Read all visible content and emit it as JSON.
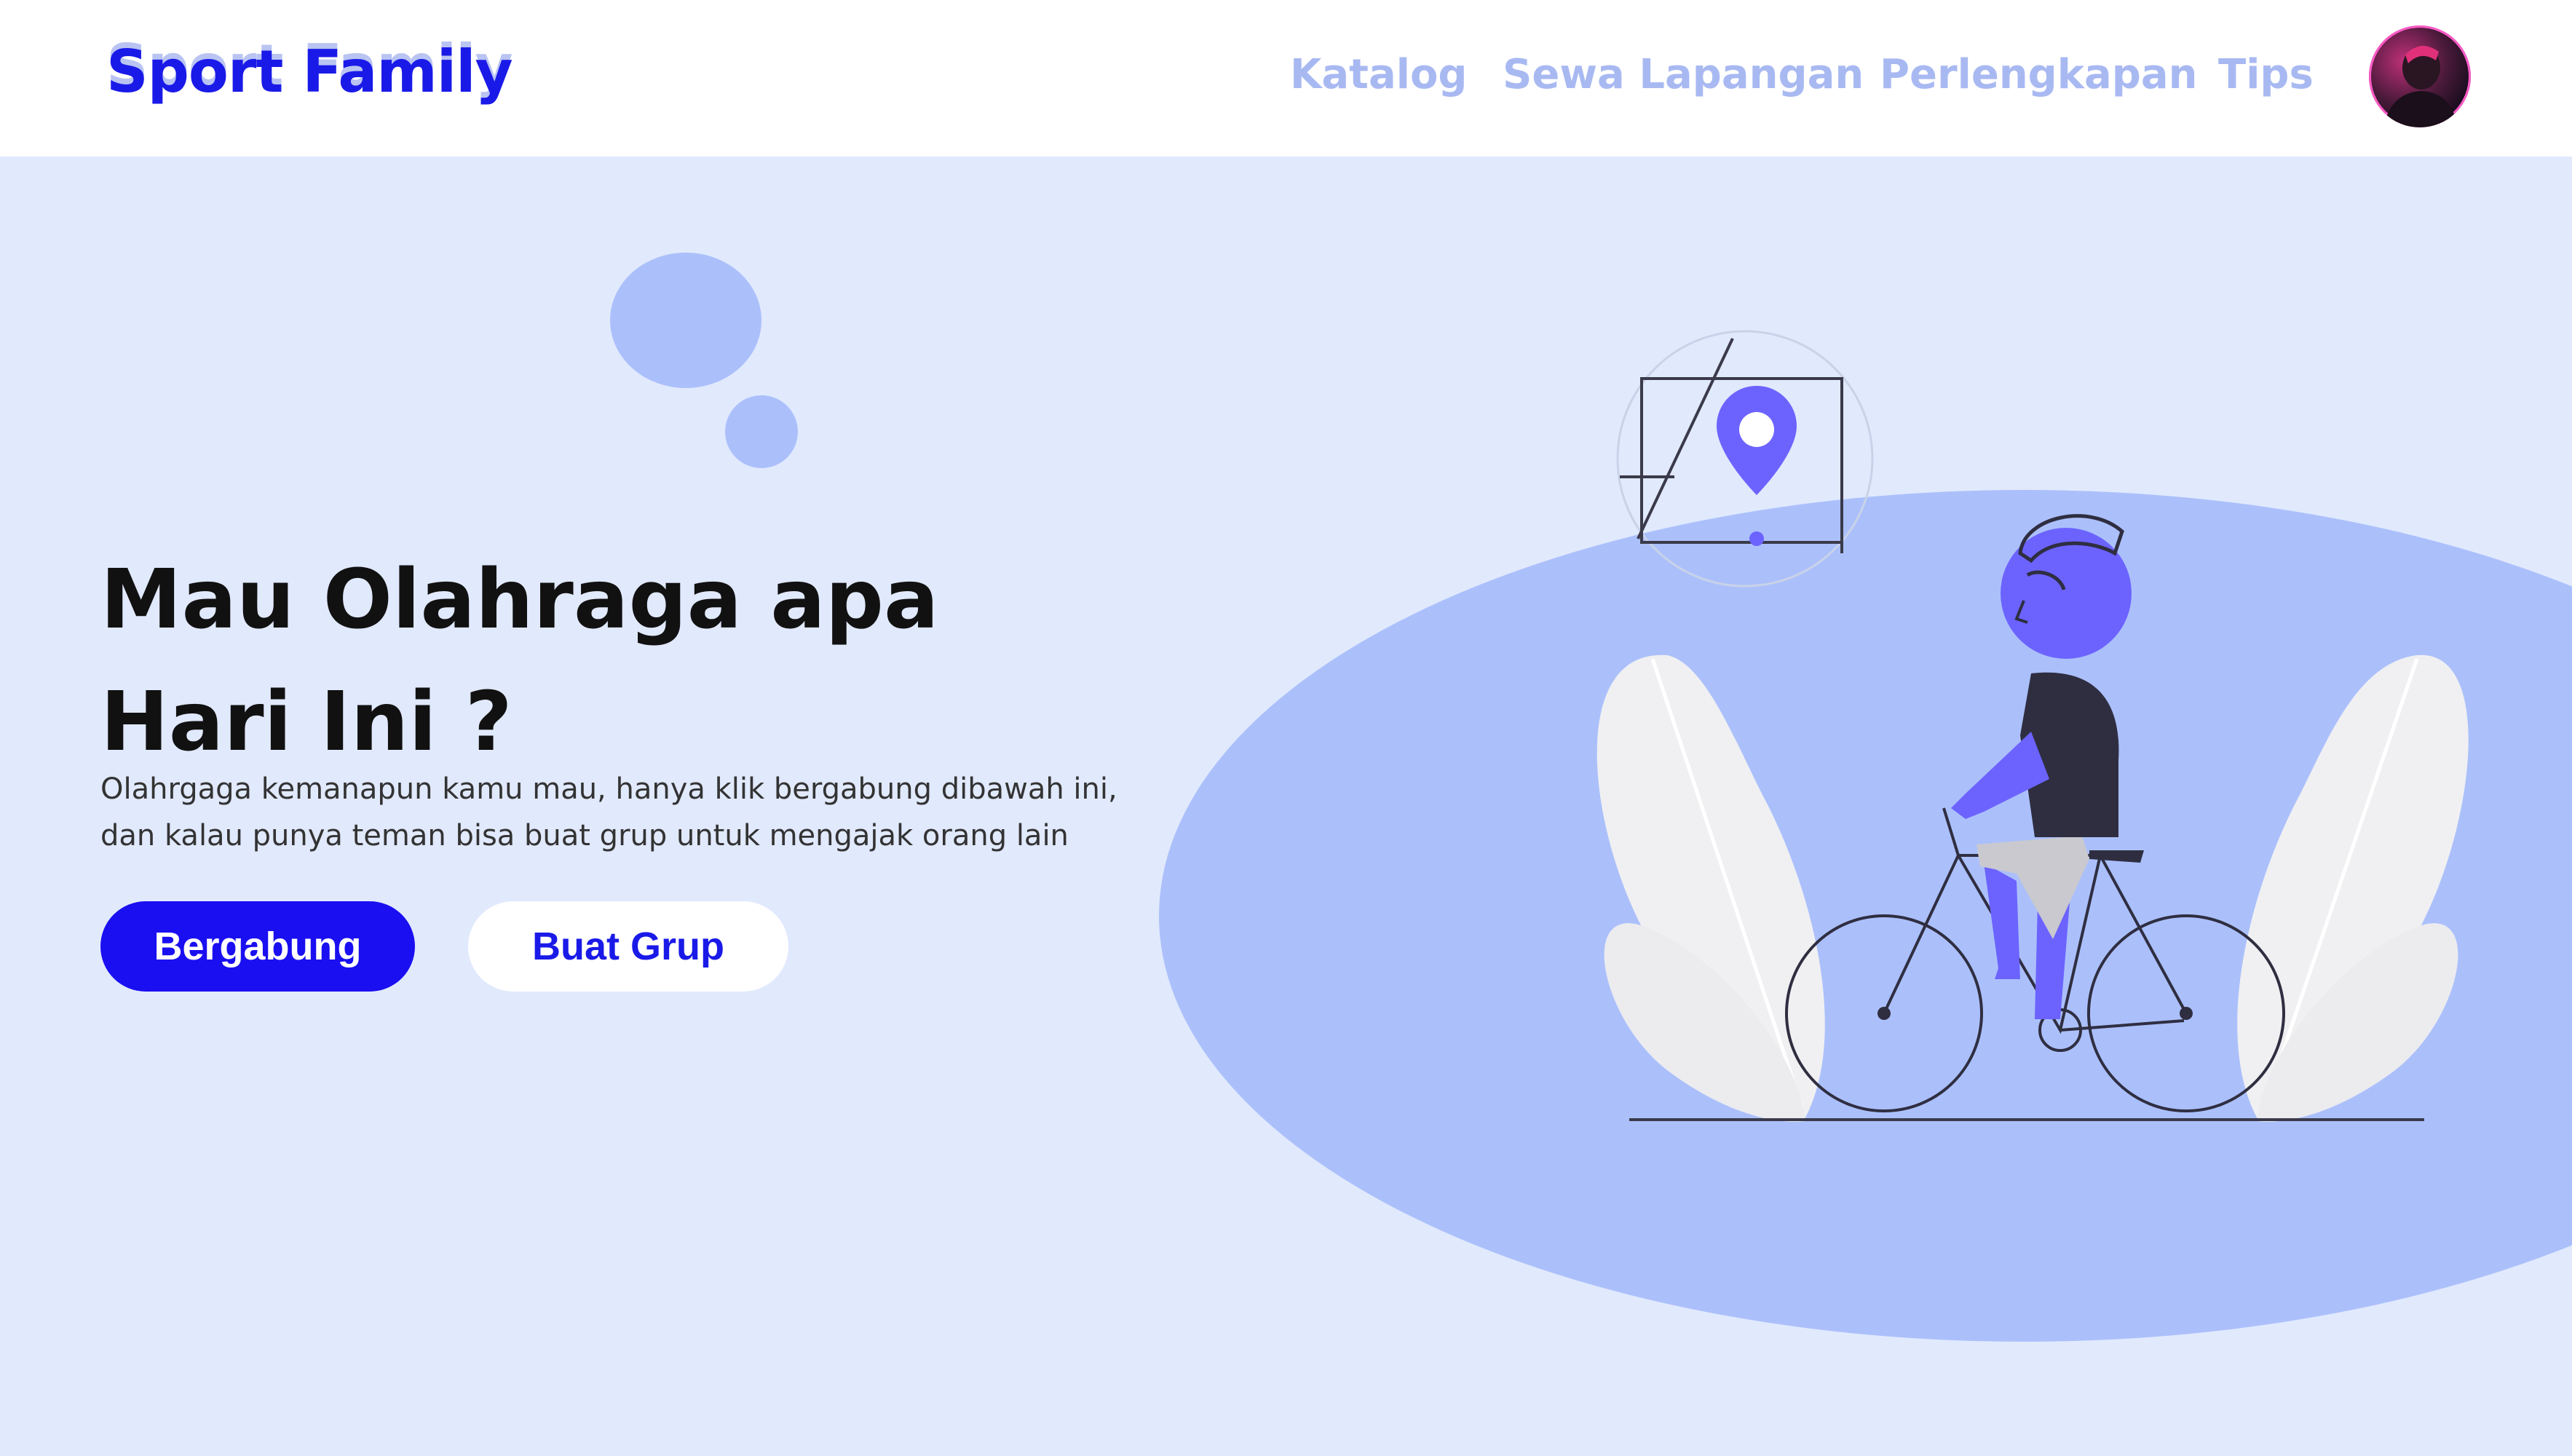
{
  "header": {
    "logo_text": "Sport Family",
    "nav": [
      {
        "label": "Katalog"
      },
      {
        "label": "Sewa Lapangan"
      },
      {
        "label": "Perlengkapan"
      },
      {
        "label": "Tips"
      }
    ],
    "avatar_icon": "user-avatar"
  },
  "hero": {
    "title_line1": "Mau Olahraga apa",
    "title_line2": "Hari Ini ?",
    "description_line1": "Olahrgaga kemanapun kamu mau, hanya klik bergabung dibawah ini,",
    "description_line2": "dan kalau punya teman bisa buat grup untuk mengajak orang lain",
    "primary_button": "Bergabung",
    "secondary_button": "Buat Grup"
  },
  "illustration": {
    "icons": [
      "location-pin-icon",
      "bicycle-icon",
      "person-cycling-icon",
      "leaf-icon"
    ]
  },
  "colors": {
    "background": "#e1e9fd",
    "accent": "#1a0ff0",
    "nav_text": "#a8b9f2",
    "blob": "#abc0fb",
    "figure": "#6c63ff"
  }
}
